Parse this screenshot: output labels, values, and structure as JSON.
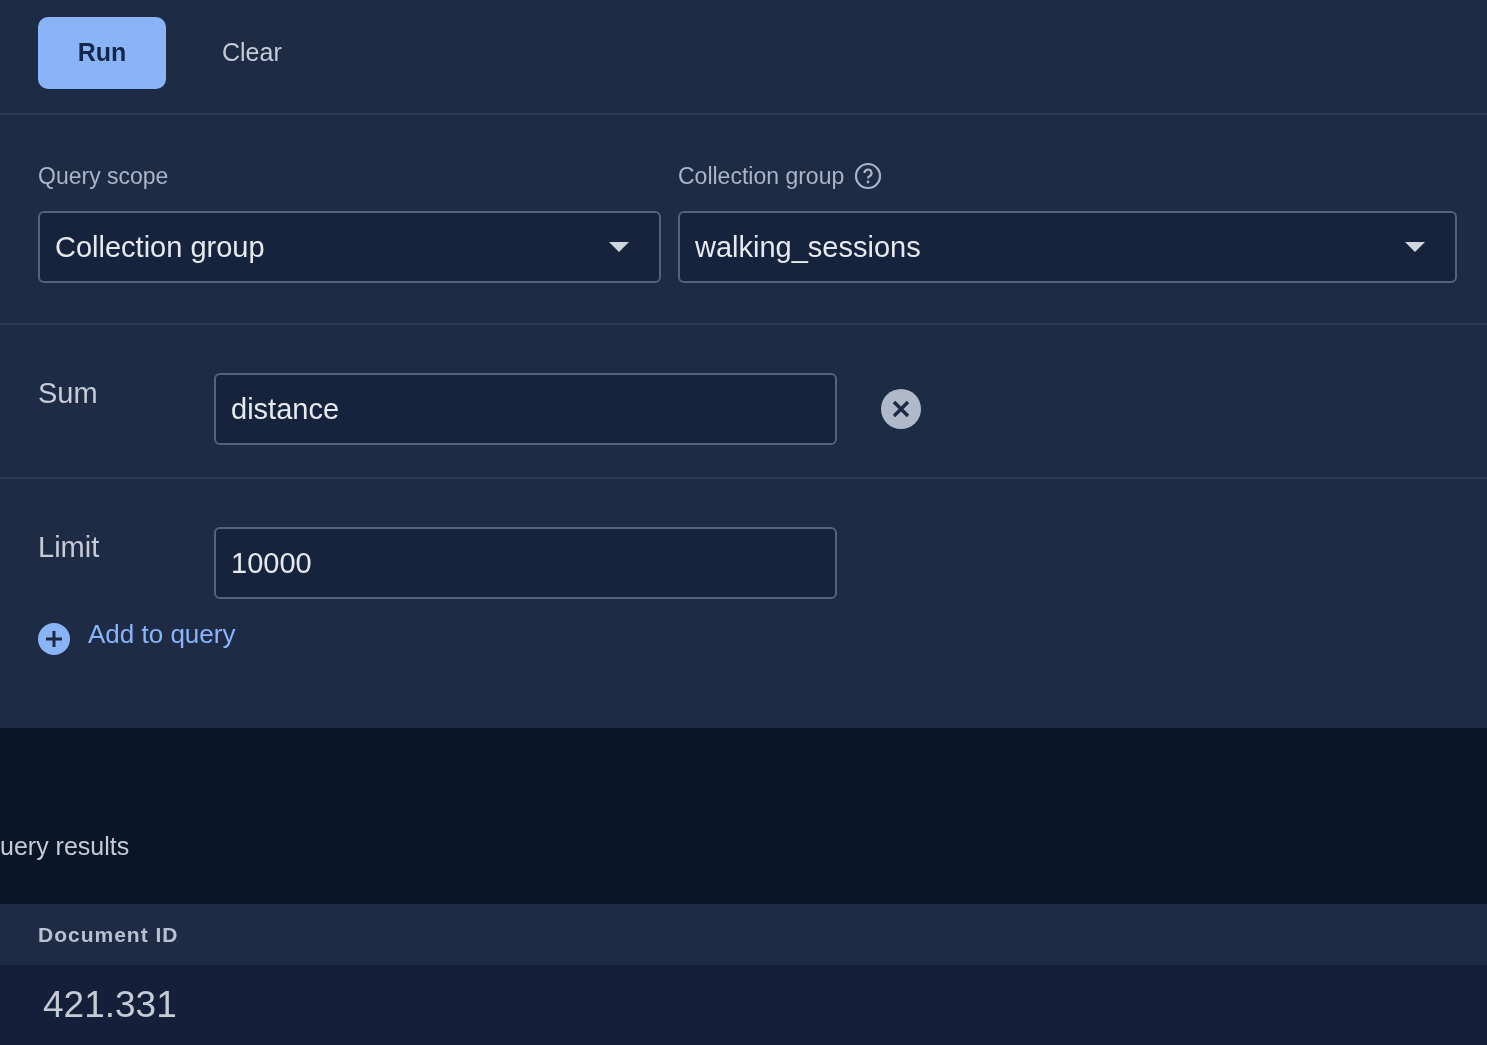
{
  "toolbar": {
    "run_label": "Run",
    "clear_label": "Clear"
  },
  "scope": {
    "query_scope_label": "Query scope",
    "query_scope_value": "Collection group",
    "collection_group_label": "Collection group",
    "collection_group_value": "walking_sessions"
  },
  "clauses": [
    {
      "kind": "sum",
      "label": "Sum",
      "value": "distance"
    },
    {
      "kind": "limit",
      "label": "Limit",
      "value": "10000"
    }
  ],
  "add_label": "Add to query",
  "results": {
    "title": "uery results",
    "column": "Document ID",
    "rows": [
      "421.331"
    ]
  }
}
